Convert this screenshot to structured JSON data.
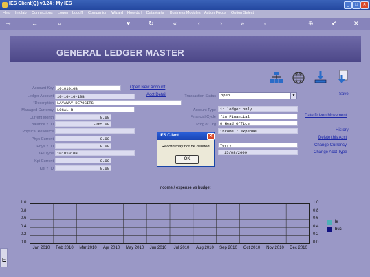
{
  "window": {
    "title": "IES Client(Q) v8.24 : My IES"
  },
  "menu": [
    "Help",
    "Infolab",
    "Connections",
    "Logon",
    "Logoff",
    "Companion",
    "Wizard",
    "How do I",
    "DataMarts",
    "Business Modules",
    "Action Focus",
    "Option Select"
  ],
  "toolbar_icons": [
    "key-icon",
    "arrow-left-icon",
    "search-icon",
    "heart-icon",
    "refresh-icon",
    "rewind-icon",
    "back-icon",
    "forward-icon",
    "fast-forward-icon",
    "lock-icon",
    "add-icon",
    "check-icon",
    "close-icon"
  ],
  "banner": {
    "title": "GENERAL LEDGER MASTER"
  },
  "form": {
    "account_key": {
      "label": "Account Key",
      "value": "10101010B"
    },
    "ledger_account": {
      "label": "Ledger Account",
      "value": "10-10-10-10B"
    },
    "description": {
      "label": "*Description",
      "value": "LAYAWAY DEPOSITS"
    },
    "managed_currency": {
      "label": "Managed Currency",
      "value": "LOCAL R"
    },
    "current_month": {
      "label": "Current Month",
      "value": "0.00"
    },
    "balance_ytd": {
      "label": "Balance YTD",
      "value": "-265.00"
    },
    "physical_resource": {
      "label": "Physical Resource",
      "value": ""
    },
    "phys_current": {
      "label": "Phys Current",
      "value": "0.00"
    },
    "phys_ytd": {
      "label": "Phys YTD",
      "value": "0.00"
    },
    "kpi_type": {
      "label": "KPI Type",
      "value": "10101010B"
    },
    "kpi_current": {
      "label": "Kpi Current",
      "value": "0.00"
    },
    "kpi_ytd": {
      "label": "Kpi YTD",
      "value": "0.00"
    },
    "transaction_status": {
      "label": "Transaction Status",
      "value": "open"
    },
    "account_type": {
      "label": "Account Type",
      "value": "1: ledger only"
    },
    "financial_cycle": {
      "label": "Financial Cycle",
      "value": "fin Financial"
    },
    "prog_or_org": {
      "label": "Prog or Org",
      "value": "0 Head Office"
    },
    "category": {
      "value": "income / expense"
    },
    "user": {
      "value": "Terry"
    },
    "date": {
      "value": "15/08/2009"
    }
  },
  "links": {
    "open_new_account": "Open New Account",
    "acct_detail": "Acct Detail",
    "save": "Save",
    "date_driven_movement": "Date Driven Movement",
    "history": "History",
    "delete_this_acct": "Delete this Acct",
    "change_currency": "Change Currency",
    "change_acct_type": "Change Acct Type"
  },
  "dialog": {
    "title": "IES Client",
    "message": "Record may not be deleted!",
    "ok_label": "OK"
  },
  "chart_data": {
    "type": "line",
    "title": "income / expense vs budget",
    "categories": [
      "Jan 2010",
      "Feb 2010",
      "Mar 2010",
      "Apr 2010",
      "May 2010",
      "Jun 2010",
      "Jul 2010",
      "Aug 2010",
      "Sep 2010",
      "Oct 2010",
      "Nov 2010",
      "Dec 2010"
    ],
    "y_ticks": [
      "1.0",
      "0.8",
      "0.6",
      "0.4",
      "0.2",
      "0.0"
    ],
    "ylim": [
      0,
      1
    ],
    "grid": true,
    "legend_position": "right",
    "series": [
      {
        "name": "ie",
        "color": "#4fb0b8",
        "values": []
      },
      {
        "name": "buc",
        "color": "#101080",
        "values": []
      }
    ]
  }
}
